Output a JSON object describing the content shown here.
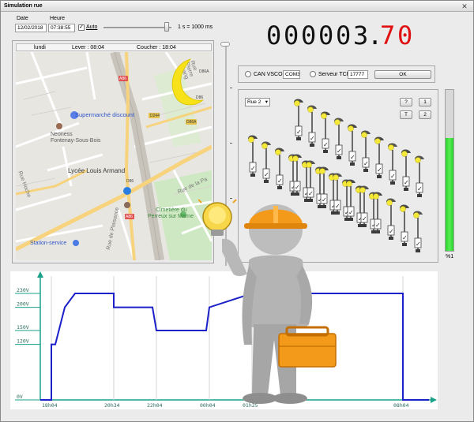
{
  "window": {
    "title": "Simulation rue",
    "close_glyph": "✕"
  },
  "controls": {
    "date_label": "Date",
    "date_value": "12/02/2018",
    "time_label": "Heure",
    "time_value": "07:38:55",
    "auto_label": "Auto",
    "auto_checked": true,
    "speed_label": "1 s = 1000 ms",
    "speed_position": 0.93
  },
  "counter": {
    "digits_white": "000003",
    "separator": ".",
    "digits_red": "70"
  },
  "sun": {
    "day": "lundi",
    "sunrise": "Lever : 08:04",
    "sunset": "Coucher : 18:04"
  },
  "map": {
    "places": [
      "Supermarché discount",
      "Neoness",
      "Fontenay-Sous-Bois",
      "Lycée Louis Armand",
      "Cimetière du",
      "Perreux sur Marne",
      "Station-service"
    ],
    "roads": [
      "Rue Hoche",
      "Rue de la Pa",
      "Rue de Plaisance",
      "Rue Pierre Grang"
    ],
    "shields": [
      "A86",
      "A86",
      "D86",
      "D244",
      "D86A",
      "D86A",
      "D86"
    ]
  },
  "connection": {
    "can_label": "CAN VSCOM",
    "can_port": "COM3",
    "server_label": "Serveur TCP",
    "server_port": "17777",
    "ok_label": "OK"
  },
  "street": {
    "selected": "Rue 2",
    "buttons": [
      "?",
      "1",
      "T",
      "2"
    ],
    "lamp_count": 30
  },
  "level": {
    "unit": "%1",
    "percent": 0.7
  },
  "chart_data": {
    "type": "line",
    "title": "",
    "xlabel": "",
    "ylabel": "",
    "x_ticks": [
      "18h04",
      "20h34",
      "22h04",
      "00h04",
      "01h25",
      "08h04"
    ],
    "y_ticks": [
      "0V",
      "120V",
      "150V",
      "200V",
      "230V"
    ],
    "ylim": [
      0,
      230
    ],
    "series": [
      {
        "color": "#1c20c8",
        "points": [
          [
            "start",
            0
          ],
          [
            "18h04",
            0
          ],
          [
            "18h04",
            120
          ],
          [
            "18h20",
            120
          ],
          [
            "18h45",
            200
          ],
          [
            "19h00",
            230
          ],
          [
            "20h34",
            230
          ],
          [
            "20h34",
            200
          ],
          [
            "21h45",
            200
          ],
          [
            "22h04",
            150
          ],
          [
            "23h50",
            150
          ],
          [
            "00h04",
            200
          ],
          [
            "01h25",
            230
          ],
          [
            "08h04",
            230
          ],
          [
            "08h04",
            0
          ],
          [
            "end",
            0
          ]
        ]
      }
    ]
  }
}
